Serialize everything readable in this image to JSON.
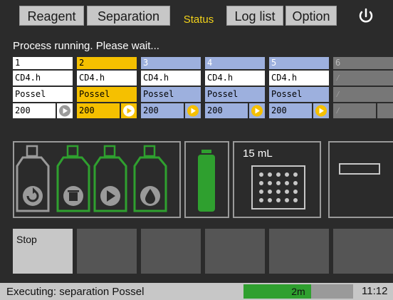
{
  "tabs": [
    {
      "label": "Reagent",
      "active": false
    },
    {
      "label": "Separation",
      "active": false
    },
    {
      "label": "Status",
      "active": true
    },
    {
      "label": "Log list",
      "active": false
    },
    {
      "label": "Option",
      "active": false
    }
  ],
  "status_message": "Process running. Please wait...",
  "columns": [
    {
      "number": "1",
      "reagent": "CD4.h",
      "program": "Possel",
      "volume": "200",
      "state": "white"
    },
    {
      "number": "2",
      "reagent": "CD4.h",
      "program": "Possel",
      "volume": "200",
      "state": "yellow"
    },
    {
      "number": "3",
      "reagent": "CD4.h",
      "program": "Possel",
      "volume": "200",
      "state": "blue"
    },
    {
      "number": "4",
      "reagent": "CD4.h",
      "program": "Possel",
      "volume": "200",
      "state": "blue"
    },
    {
      "number": "5",
      "reagent": "CD4.h",
      "program": "Possel",
      "volume": "200",
      "state": "blue"
    },
    {
      "number": "6",
      "reagent": "⁄",
      "program": "⁄",
      "volume": "⁄",
      "state": "disabled"
    }
  ],
  "rack_label": "15 mL",
  "bottles": [
    {
      "icon": "rotate-icon",
      "color": "#9a9a9a"
    },
    {
      "icon": "trash-icon",
      "color": "#2fa02f"
    },
    {
      "icon": "play-icon",
      "color": "#2fa02f"
    },
    {
      "icon": "drop-icon",
      "color": "#2fa02f"
    }
  ],
  "colors": {
    "accent_yellow": "#f5c000",
    "blue": "#9db0de",
    "green": "#2fa02f",
    "active_tab": "#f2d21a"
  },
  "buttons": {
    "stop_label": "Stop"
  },
  "footer": {
    "executing": "Executing: separation Possel",
    "progress_label": "2m",
    "progress": 0.62,
    "time": "11:12"
  }
}
